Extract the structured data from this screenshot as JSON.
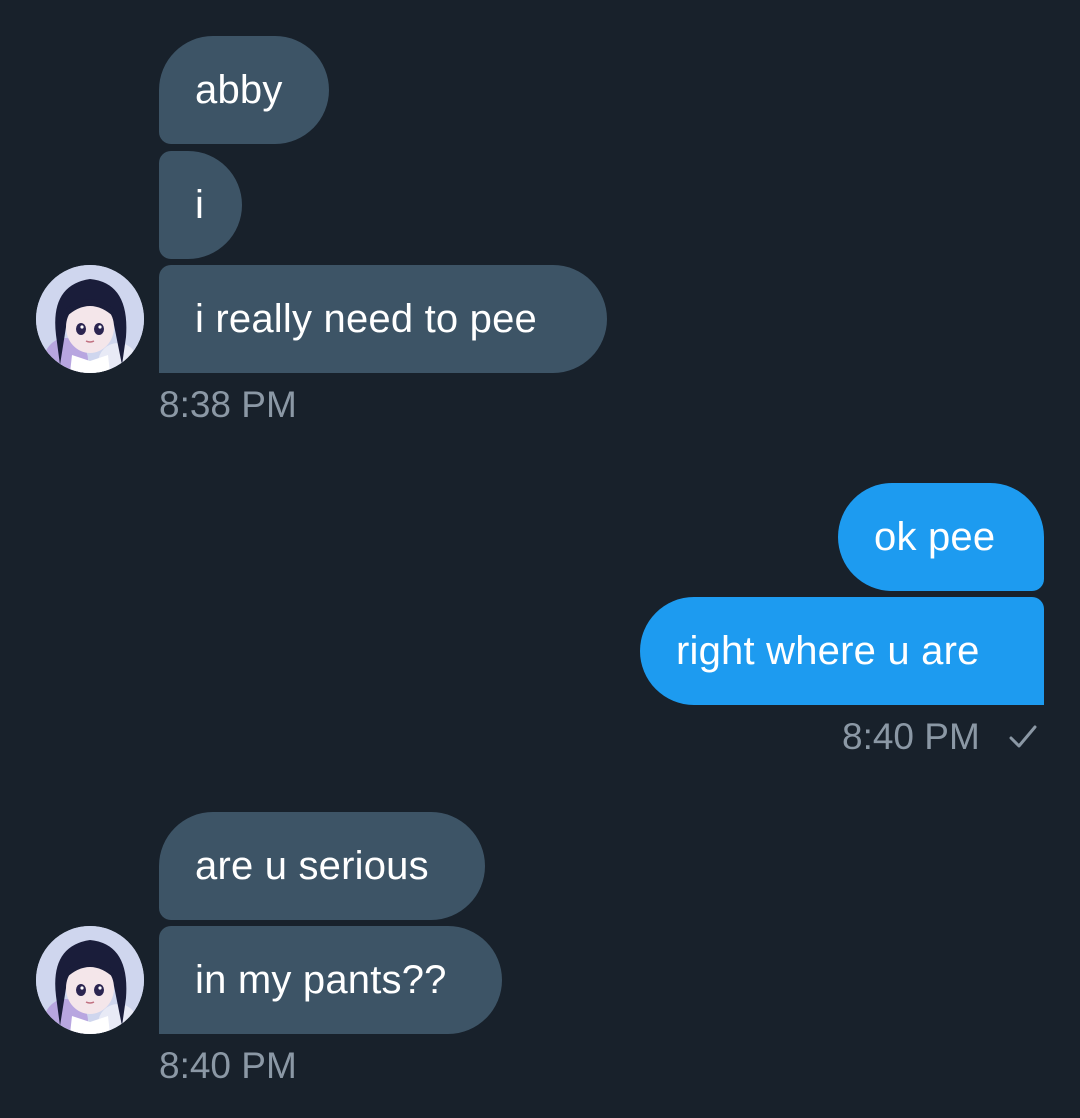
{
  "thread": {
    "group1": {
      "messages": [
        "abby",
        "i",
        "i really need to pee"
      ],
      "timestamp": "8:38 PM"
    },
    "group2": {
      "messages": [
        "ok pee",
        "right where u are"
      ],
      "timestamp": "8:40 PM",
      "read_status_icon": "checkmark-icon"
    },
    "group3": {
      "messages": [
        "are u serious",
        "in my pants??"
      ],
      "timestamp": "8:40 PM"
    }
  },
  "colors": {
    "background": "#18212b",
    "incoming_bubble": "#3d5466",
    "outgoing_bubble": "#1d9bf0",
    "timestamp": "#8b98a5"
  },
  "icons": {
    "avatar": "anime-girl-avatar-icon",
    "read_receipt": "checkmark-icon"
  }
}
